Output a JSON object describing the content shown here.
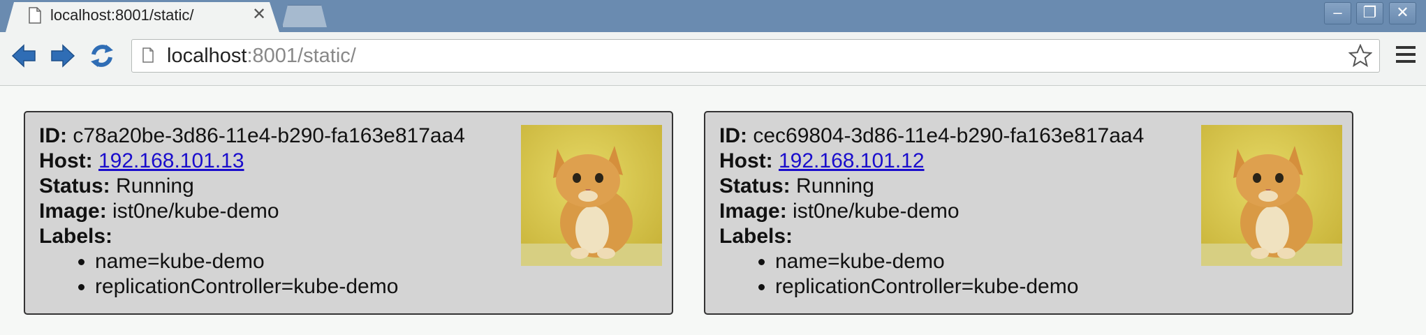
{
  "browser": {
    "tab_title": "localhost:8001/static/",
    "tab_close_glyph": "✕",
    "url_host": "localhost",
    "url_rest": ":8001/static/",
    "window_controls": {
      "minimize": "–",
      "maximize": "❐",
      "close": "✕"
    },
    "icons": [
      "page-icon",
      "back-arrow-icon",
      "forward-arrow-icon",
      "reload-icon",
      "star-icon",
      "menu-icon"
    ]
  },
  "labels_text": {
    "id": "ID:",
    "host": "Host:",
    "status": "Status:",
    "image": "Image:",
    "labels": "Labels:"
  },
  "pods": [
    {
      "id": "c78a20be-3d86-11e4-b290-fa163e817aa4",
      "host": "192.168.101.13",
      "status": "Running",
      "image": "ist0ne/kube-demo",
      "labels": [
        "name=kube-demo",
        "replicationController=kube-demo"
      ],
      "picture": "kitten-photo"
    },
    {
      "id": "cec69804-3d86-11e4-b290-fa163e817aa4",
      "host": "192.168.101.12",
      "status": "Running",
      "image": "ist0ne/kube-demo",
      "labels": [
        "name=kube-demo",
        "replicationController=kube-demo"
      ],
      "picture": "kitten-photo"
    }
  ],
  "colors": {
    "titlebar": "#6a8bb0",
    "card_background": "#d4d4d4",
    "link": "#1a0dcc",
    "nav_arrow": "#2f6db5"
  }
}
